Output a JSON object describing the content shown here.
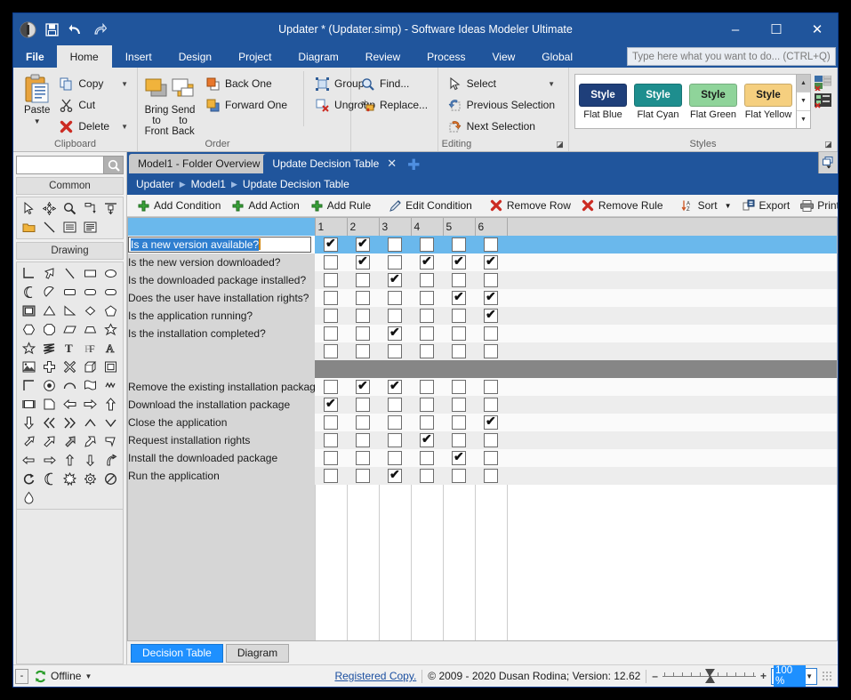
{
  "window": {
    "title": "Updater * (Updater.simp) - Software Ideas Modeler Ultimate",
    "minimize": "–",
    "maximize": "☐",
    "close": "✕"
  },
  "quick_access": [
    "app-logo-icon",
    "save-icon",
    "undo-icon",
    "redo-icon"
  ],
  "ribbon": {
    "tabs": [
      {
        "label": "File",
        "active": false,
        "file": true
      },
      {
        "label": "Home",
        "active": true
      },
      {
        "label": "Insert",
        "active": false
      },
      {
        "label": "Design",
        "active": false
      },
      {
        "label": "Project",
        "active": false
      },
      {
        "label": "Diagram",
        "active": false
      },
      {
        "label": "Review",
        "active": false
      },
      {
        "label": "Process",
        "active": false
      },
      {
        "label": "View",
        "active": false
      },
      {
        "label": "Global",
        "active": false
      }
    ],
    "search_placeholder": "Type here what you want to do...  (CTRL+Q)",
    "groups": {
      "clipboard": {
        "label": "Clipboard",
        "paste": "Paste",
        "copy": "Copy",
        "cut": "Cut",
        "delete": "Delete"
      },
      "order": {
        "label": "Order",
        "bring_to_front": "Bring to\nFront",
        "bring_to_front_l1": "Bring to",
        "bring_to_front_l2": "Front",
        "send_to_back_l1": "Send to",
        "send_to_back_l2": "Back",
        "back_one": "Back One",
        "forward_one": "Forward One",
        "group": "Group",
        "ungroup": "Ungroup"
      },
      "find": {
        "find": "Find...",
        "replace": "Replace..."
      },
      "editing": {
        "label": "Editing",
        "select": "Select",
        "previous_selection": "Previous Selection",
        "next_selection": "Next Selection"
      },
      "styles": {
        "label": "Styles",
        "items": [
          {
            "name": "Flat Blue",
            "swatch_text": "Style",
            "color": "#1f3f7a",
            "text_color": "#ffffff"
          },
          {
            "name": "Flat Cyan",
            "swatch_text": "Style",
            "color": "#1e8e8e",
            "text_color": "#ffffff"
          },
          {
            "name": "Flat Green",
            "swatch_text": "Style",
            "color": "#8fd49a",
            "text_color": "#1b1b1b"
          },
          {
            "name": "Flat Yellow",
            "swatch_text": "Style",
            "color": "#f5cf7f",
            "text_color": "#1b1b1b"
          }
        ]
      }
    }
  },
  "toolbox": {
    "search_value": "",
    "sections": [
      {
        "title": "Common",
        "icons": [
          "cursor-icon",
          "move-icon",
          "zoom-icon",
          "connector-icon",
          "align-icon",
          "folder-icon",
          "line-icon",
          "note-icon",
          "text-block-icon"
        ]
      },
      {
        "title": "Drawing",
        "icons": [
          "corner-icon",
          "arrow-cursor-icon",
          "line-icon",
          "rectangle-icon",
          "ellipse-icon",
          "moon-icon",
          "drop-shape-icon",
          "rounded-rect-icon",
          "rounded-rect2-icon",
          "stadium-icon",
          "frame-icon",
          "triangle-icon",
          "right-triangle-icon",
          "diamond-icon",
          "pentagon-icon",
          "hexagon-icon",
          "octagon-icon",
          "parallelogram-icon",
          "trapezoid-icon",
          "star5-icon",
          "star-outline-icon",
          "zigzag-icon",
          "text-bold-icon",
          "text-fancy-icon",
          "text-outline-icon",
          "image-icon",
          "cross-icon",
          "x-cross-icon",
          "cube-icon",
          "square-frame-icon",
          "angle-icon",
          "circle-target-icon",
          "arc-icon",
          "flag-icon",
          "wave-icon",
          "bracket-icon",
          "page-icon",
          "arrow-left-icon",
          "arrow-right-icon",
          "arrow-up-icon",
          "arrow-down-icon",
          "chevrons-left-icon",
          "chevrons-right-icon",
          "chevron-up-icon",
          "chevron-down-icon",
          "arrow-ne-icon",
          "arrow-bent-icon",
          "arrow-block-icon",
          "arrow-turn-icon",
          "arrow-corner-icon",
          "arrow-in-icon",
          "arrow-out-icon",
          "arrow-up-block-icon",
          "arrow-down-block-icon",
          "arrow-curve-icon",
          "refresh-icon",
          "crescent-icon",
          "burst-icon",
          "gear-icon",
          "no-entry-icon",
          "drop-icon"
        ]
      }
    ]
  },
  "document": {
    "tabs": [
      {
        "label": "Model1 - Folder Overview",
        "active": false,
        "closable": false
      },
      {
        "label": "Update Decision Table",
        "active": true,
        "closable": true
      }
    ],
    "new_tab_icon": "add-tab-icon",
    "breadcrumb": [
      "Updater",
      "Model1",
      "Update Decision Table"
    ],
    "commands": [
      {
        "label": "Add Condition",
        "icon": "plus-green-icon"
      },
      {
        "label": "Add Action",
        "icon": "plus-green-icon"
      },
      {
        "label": "Add Rule",
        "icon": "plus-green-icon"
      },
      {
        "label": "Edit Condition",
        "icon": "pencil-icon"
      },
      {
        "label": "Remove Row",
        "icon": "delete-red-icon"
      },
      {
        "label": "Remove Rule",
        "icon": "delete-red-icon"
      },
      {
        "label": "Sort",
        "icon": "sort-icon",
        "dropdown": true
      },
      {
        "label": "Export",
        "icon": "export-icon"
      },
      {
        "label": "Print",
        "icon": "printer-icon"
      }
    ],
    "view_tabs": [
      {
        "label": "Decision Table",
        "active": true
      },
      {
        "label": "Diagram",
        "active": false
      }
    ]
  },
  "decision_table": {
    "rule_columns": [
      "1",
      "2",
      "3",
      "4",
      "5",
      "6"
    ],
    "selected_row_index": 0,
    "editing_text": "Is a new version available?",
    "conditions": [
      {
        "label": "Is a new version available?",
        "values": [
          true,
          true,
          false,
          false,
          false,
          false
        ]
      },
      {
        "label": "Is the new version downloaded?",
        "values": [
          false,
          true,
          false,
          true,
          true,
          true
        ]
      },
      {
        "label": "Is the downloaded package installed?",
        "values": [
          false,
          false,
          true,
          false,
          false,
          false
        ]
      },
      {
        "label": "Does the user have installation rights?",
        "values": [
          false,
          false,
          false,
          false,
          true,
          true
        ]
      },
      {
        "label": "Is the application running?",
        "values": [
          false,
          false,
          false,
          false,
          false,
          true
        ]
      },
      {
        "label": "Is the installation completed?",
        "values": [
          false,
          false,
          true,
          false,
          false,
          false
        ]
      }
    ],
    "actions": [
      {
        "label": "Remove the existing installation package",
        "values": [
          false,
          true,
          true,
          false,
          false,
          false
        ]
      },
      {
        "label": "Download the installation package",
        "values": [
          true,
          false,
          false,
          false,
          false,
          false
        ]
      },
      {
        "label": "Close the application",
        "values": [
          false,
          false,
          false,
          false,
          false,
          true
        ]
      },
      {
        "label": "Request installation rights",
        "values": [
          false,
          false,
          false,
          true,
          false,
          false
        ]
      },
      {
        "label": "Install the downloaded package",
        "values": [
          false,
          false,
          false,
          false,
          true,
          false
        ]
      },
      {
        "label": "Run the application",
        "values": [
          false,
          false,
          true,
          false,
          false,
          false
        ]
      }
    ]
  },
  "status_bar": {
    "collapse_label": "-",
    "connection": "Offline",
    "registered": "Registered Copy.",
    "copyright": "© 2009 - 2020 Dusan Rodina; Version: 12.62",
    "zoom_out": "–",
    "zoom_in": "+",
    "zoom_value": "100 %"
  }
}
